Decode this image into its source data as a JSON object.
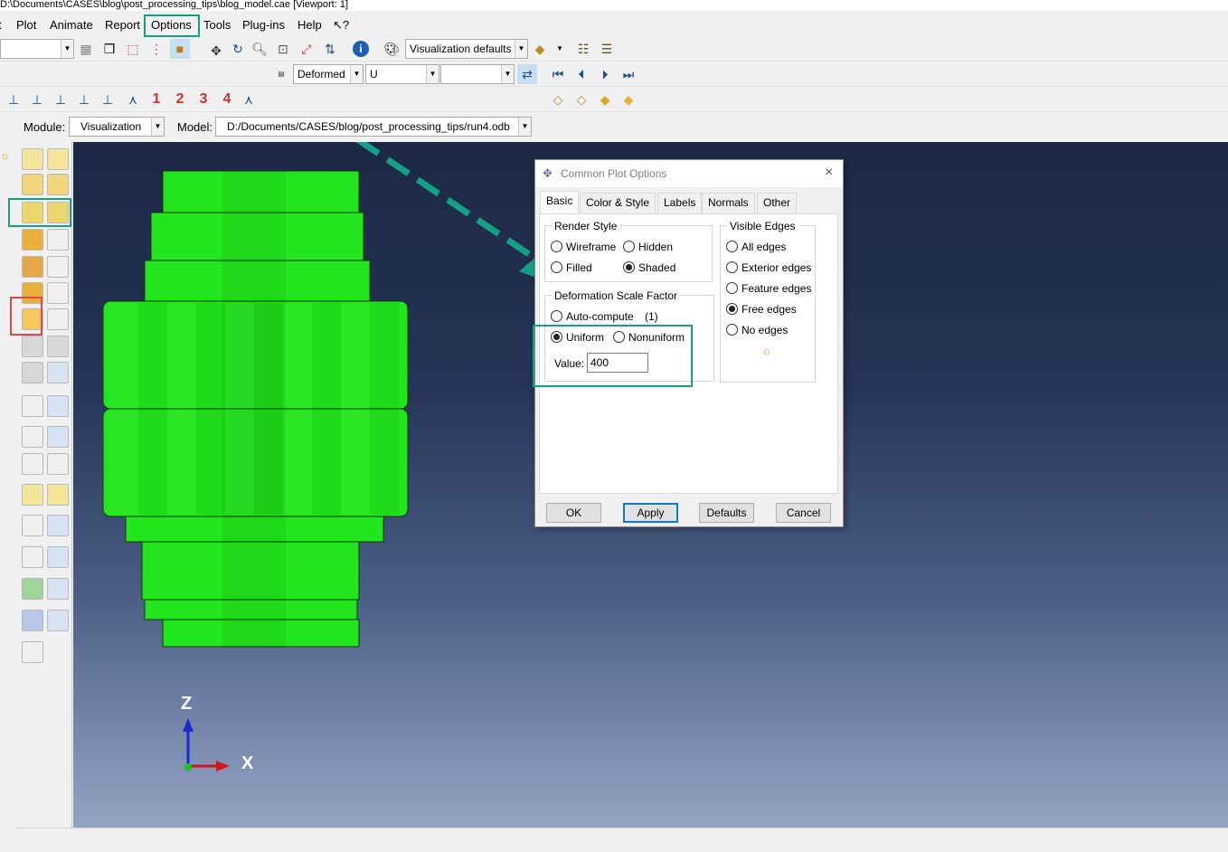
{
  "window": {
    "title": "D:\\Documents\\CASES\\blog\\post_processing_tips\\blog_model.cae [Viewport: 1]"
  },
  "menu": [
    "Plot",
    "Animate",
    "Report",
    "Options",
    "Tools",
    "Plug-ins",
    "Help",
    "?"
  ],
  "toolbar": {
    "combo_left_value": "",
    "render_style": "Visualization defaults",
    "deformed_combo": "Deformed",
    "variable_combo": "U",
    "component_combo": "",
    "step_labels": [
      "1",
      "2",
      "3",
      "4"
    ]
  },
  "context": {
    "module_label": "Module:",
    "module_value": "Visualization",
    "model_label": "Model:",
    "model_value": "D:/Documents/CASES/blog/post_processing_tips/run4.odb"
  },
  "triad": {
    "z": "Z",
    "x": "X"
  },
  "dialog": {
    "title": "Common Plot Options",
    "tabs": [
      "Basic",
      "Color & Style",
      "Labels",
      "Normals",
      "Other"
    ],
    "render_style": {
      "title": "Render Style",
      "options": [
        "Wireframe",
        "Hidden",
        "Filled",
        "Shaded"
      ],
      "selected": "Shaded"
    },
    "deformation": {
      "title": "Deformation Scale Factor",
      "auto": "Auto-compute",
      "auto_value": "(1)",
      "uniform": "Uniform",
      "nonuniform": "Nonuniform",
      "selected": "Uniform",
      "value_label": "Value:",
      "value": "400"
    },
    "visible_edges": {
      "title": "Visible Edges",
      "options": [
        "All edges",
        "Exterior edges",
        "Feature edges",
        "Free edges",
        "No edges"
      ],
      "selected": "Free edges"
    },
    "buttons": [
      "OK",
      "Apply",
      "Defaults",
      "Cancel"
    ]
  },
  "colors": {
    "highlight_teal": "#14a085",
    "highlight_red": "#e0474b",
    "mesh_green": "#22e51d",
    "viewport_top": "#1c2845",
    "viewport_bottom": "#95a4c4"
  }
}
